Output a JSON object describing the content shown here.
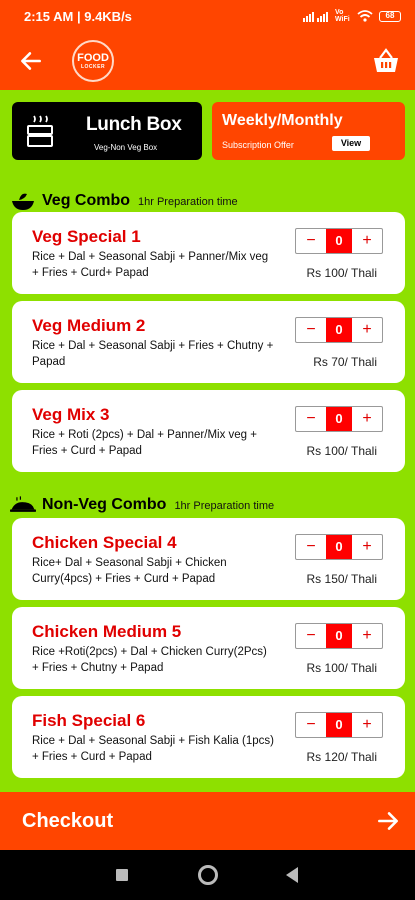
{
  "status": {
    "time": "2:15 AM | 9.4KB/s",
    "battery": "68",
    "network": "Vo WiFi"
  },
  "colors": {
    "primary": "#ff4500",
    "background": "#8ee000",
    "accent_red": "#e00000"
  },
  "banners": {
    "lunch": {
      "title": "Lunch Box",
      "subtitle": "Veg-Non Veg Box",
      "icon": "lunch-box-icon"
    },
    "weekly": {
      "title": "Weekly/Monthly",
      "subtitle": "Subscription Offer",
      "button": "View"
    }
  },
  "veg": {
    "title": "Veg Combo",
    "time": "1hr Preparation time",
    "items": [
      {
        "name": "Veg Special 1",
        "desc": "Rice + Dal + Seasonal Sabji + Panner/Mix veg + Fries + Curd+ Papad",
        "qty": "0",
        "price": "Rs 100/ Thali"
      },
      {
        "name": "Veg Medium 2",
        "desc": "Rice + Dal + Seasonal Sabji + Fries + Chutny + Papad",
        "qty": "0",
        "price": "Rs 70/ Thali"
      },
      {
        "name": "Veg Mix 3",
        "desc": "Rice + Roti (2pcs) + Dal + Panner/Mix veg + Fries + Curd + Papad",
        "qty": "0",
        "price": "Rs 100/ Thali"
      }
    ]
  },
  "nonveg": {
    "title": "Non-Veg Combo",
    "time": "1hr Preparation time",
    "items": [
      {
        "name": "Chicken Special 4",
        "desc": "Rice+ Dal + Seasonal Sabji + Chicken Curry(4pcs) + Fries + Curd + Papad",
        "qty": "0",
        "price": "Rs 150/ Thali"
      },
      {
        "name": "Chicken Medium 5",
        "desc": "Rice +Roti(2pcs) + Dal + Chicken Curry(2Pcs) + Fries + Chutny + Papad",
        "qty": "0",
        "price": "Rs 100/ Thali"
      },
      {
        "name": "Fish Special 6",
        "desc": "Rice + Dal + Seasonal Sabji + Fish Kalia (1pcs) + Fries + Curd + Papad",
        "qty": "0",
        "price": "Rs 120/ Thali"
      }
    ]
  },
  "stepper": {
    "minus": "−",
    "plus": "+"
  },
  "checkout": {
    "label": "Checkout"
  }
}
